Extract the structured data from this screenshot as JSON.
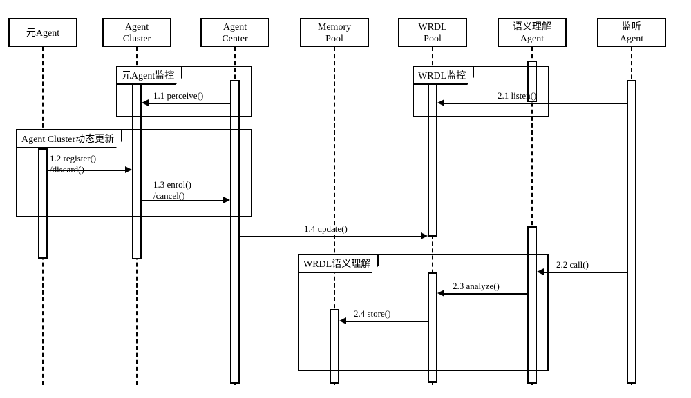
{
  "lifelines": {
    "meta_agent": "元Agent",
    "agent_cluster_l1": "Agent",
    "agent_cluster_l2": "Cluster",
    "agent_center_l1": "Agent",
    "agent_center_l2": "Center",
    "memory_pool_l1": "Memory",
    "memory_pool_l2": "Pool",
    "wrdl_pool_l1": "WRDL",
    "wrdl_pool_l2": "Pool",
    "semantic_agent_l1": "语义理解",
    "semantic_agent_l2": "Agent",
    "listen_agent_l1": "监听",
    "listen_agent_l2": "Agent"
  },
  "frames": {
    "meta_monitor": "元Agent监控",
    "wrdl_monitor": "WRDL监控",
    "cluster_update": "Agent Cluster动态更新",
    "wrdl_semantic": "WRDL语义理解"
  },
  "messages": {
    "m11": "1.1 perceive()",
    "m12_l1": "1.2 register()",
    "m12_l2": "/discard()",
    "m13_l1": "1.3 enrol()",
    "m13_l2": "/cancel()",
    "m14": "1.4 update()",
    "m21": "2.1 listen()",
    "m22": "2.2 call()",
    "m23": "2.3 analyze()",
    "m24": "2.4 store()"
  }
}
